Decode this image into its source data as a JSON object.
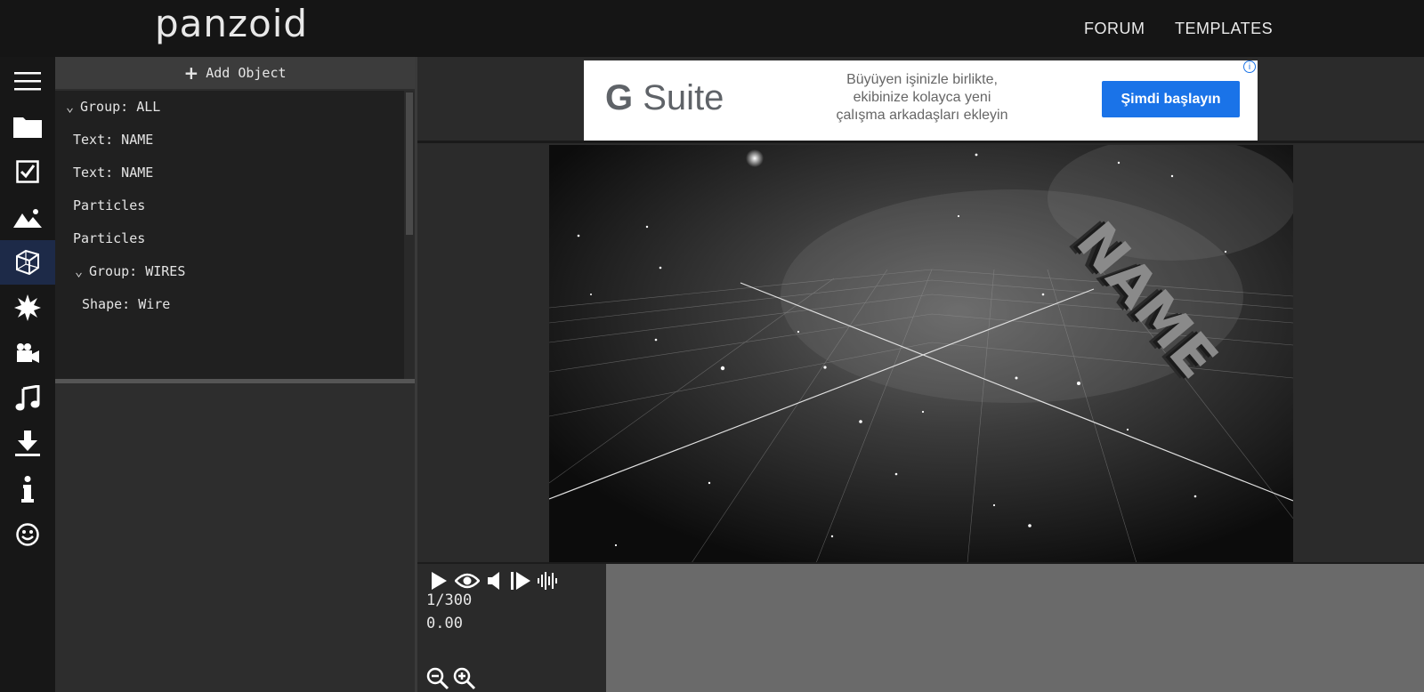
{
  "app": {
    "logo": "panzoid"
  },
  "nav": {
    "forum": "FORUM",
    "templates": "TEMPLATES"
  },
  "rail": [
    {
      "name": "menu-icon",
      "active": false
    },
    {
      "name": "folder-icon",
      "active": false
    },
    {
      "name": "checkbox-icon",
      "active": false
    },
    {
      "name": "landscape-icon",
      "active": false
    },
    {
      "name": "cube-icon",
      "active": true
    },
    {
      "name": "burst-icon",
      "active": false
    },
    {
      "name": "camera-icon",
      "active": false
    },
    {
      "name": "music-note-icon",
      "active": false
    },
    {
      "name": "download-icon",
      "active": false
    },
    {
      "name": "info-icon",
      "active": false
    },
    {
      "name": "smiley-icon",
      "active": false
    }
  ],
  "panel": {
    "add_object": "Add Object",
    "tree": [
      {
        "label": "Group: ALL",
        "group": true,
        "level": 0
      },
      {
        "label": "Text: NAME",
        "group": false,
        "level": 0
      },
      {
        "label": "Text: NAME",
        "group": false,
        "level": 0
      },
      {
        "label": "Particles",
        "group": false,
        "level": 0
      },
      {
        "label": "Particles",
        "group": false,
        "level": 0
      },
      {
        "label": "Group: WIRES",
        "group": true,
        "level": 1
      },
      {
        "label": "Shape: Wire",
        "group": false,
        "level": 1
      }
    ]
  },
  "ad": {
    "brand_g": "G",
    "brand": "Suite",
    "text_line1": "Büyüyen işinizle birlikte,",
    "text_line2": "ekibinize kolayca yeni",
    "text_line3": "çalışma arkadaşları ekleyin",
    "cta": "Şimdi başlayın",
    "info": "i",
    "accent": "#1a73e8"
  },
  "viewport": {
    "text": "NAME"
  },
  "timeline": {
    "frame": "1/300",
    "time": "0.00",
    "controls": [
      "play-icon",
      "eye-icon",
      "volume-icon",
      "step-forward-icon",
      "waveform-icon"
    ],
    "zoom": [
      "zoom-out-icon",
      "zoom-in-icon"
    ]
  }
}
